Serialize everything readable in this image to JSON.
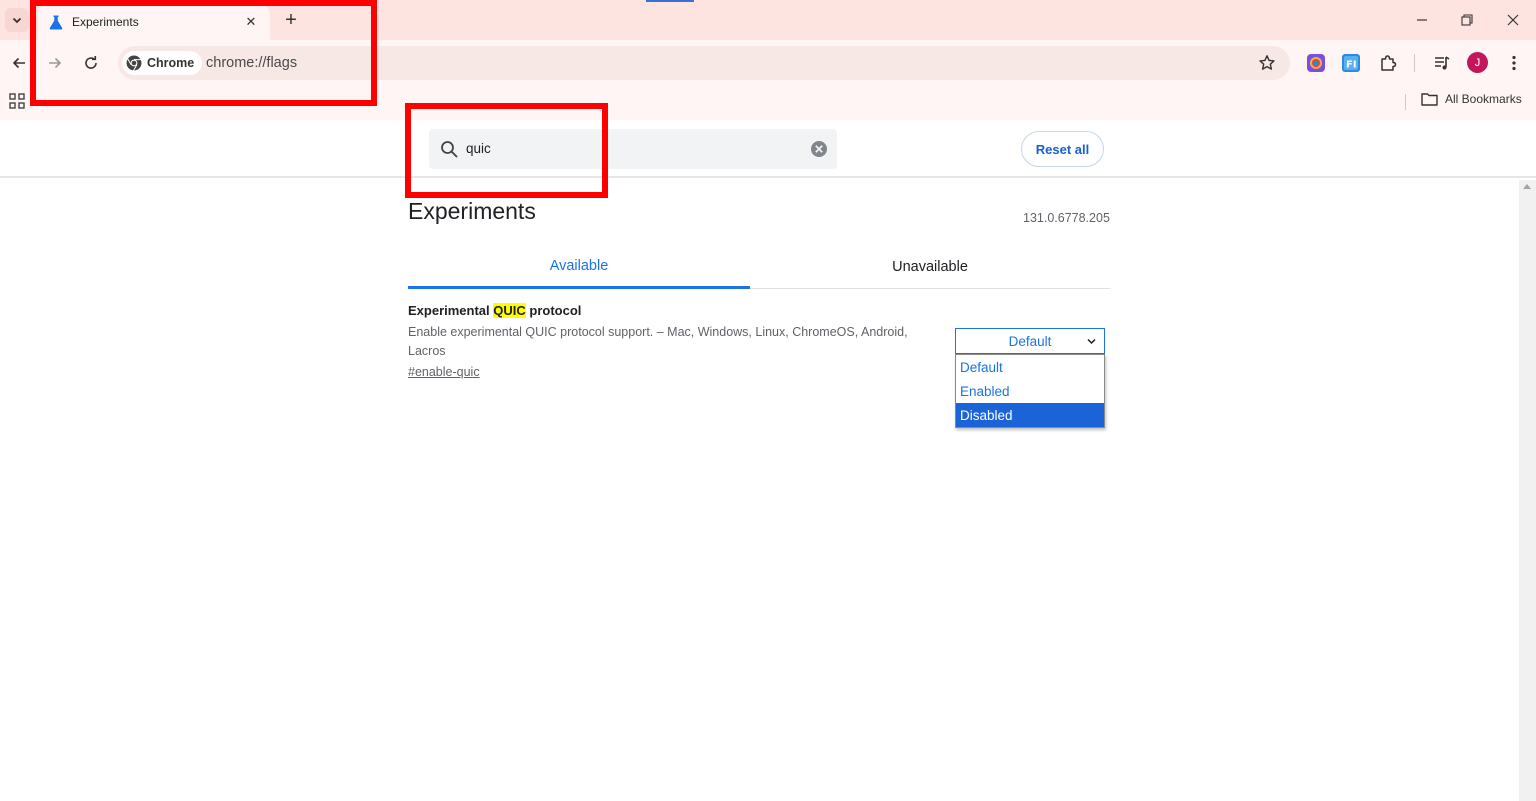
{
  "browser": {
    "tab": {
      "title": "Experiments"
    },
    "new_tab_symbol": "+",
    "chip_label": "Chrome",
    "url": "chrome://flags",
    "avatar_letter": "J",
    "bookmarks_label": "All Bookmarks"
  },
  "flags": {
    "search": {
      "value": "quic"
    },
    "reset_label": "Reset all",
    "title": "Experiments",
    "version": "131.0.6778.205",
    "tabs": [
      {
        "label": "Available",
        "active": true
      },
      {
        "label": "Unavailable",
        "active": false
      }
    ],
    "experiment": {
      "title_before": "Experimental ",
      "title_highlight": "QUIC",
      "title_after": " protocol",
      "description": "Enable experimental QUIC protocol support. – Mac, Windows, Linux, ChromeOS, Android, Lacros",
      "link": "#enable-quic",
      "select_value": "Default",
      "options": [
        "Default",
        "Enabled",
        "Disabled"
      ],
      "highlighted_option": "Disabled"
    }
  },
  "colors": {
    "accent": "#1a73e8",
    "annotation": "#ff0000",
    "highlight": "#ffff00",
    "tabstrip": "#fde4e1"
  }
}
